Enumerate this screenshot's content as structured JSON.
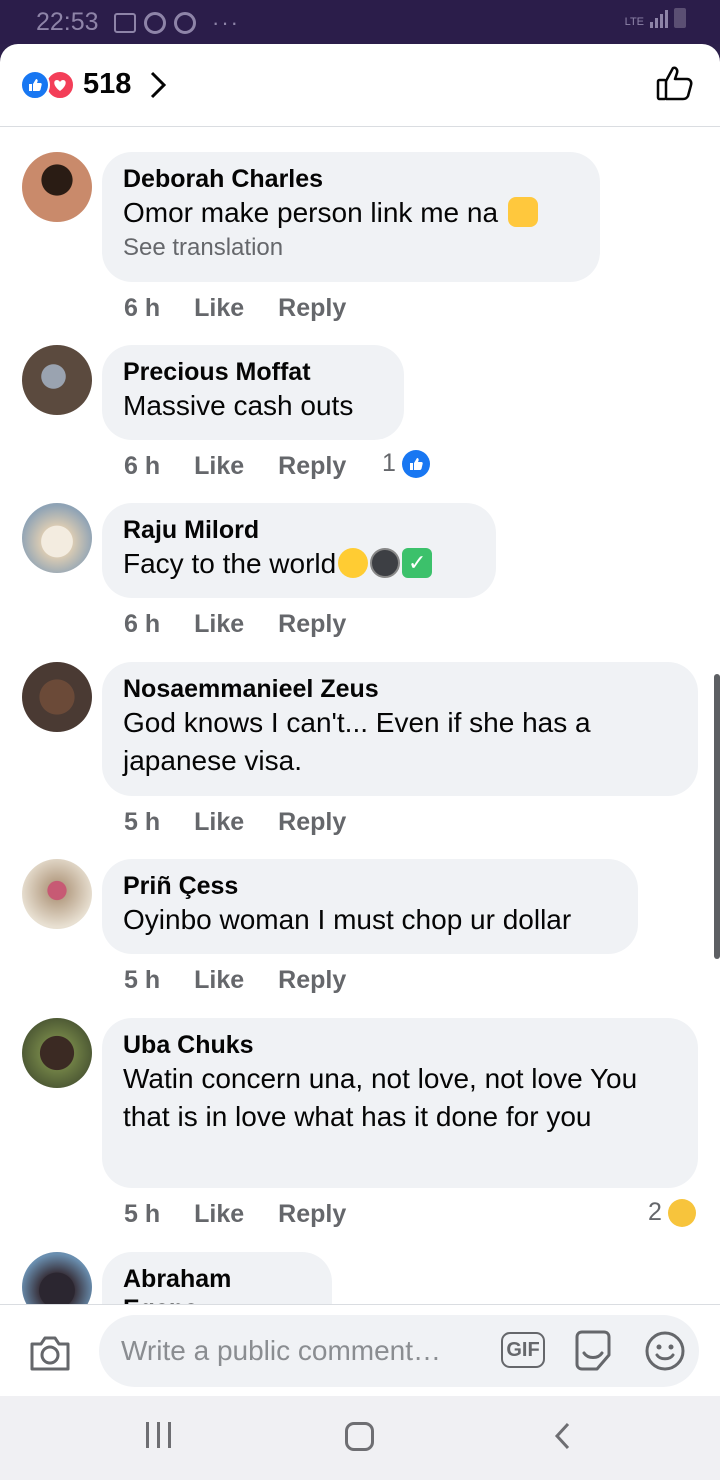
{
  "status_bar": {
    "time": "22:53",
    "network": "LTE"
  },
  "header": {
    "reaction_count": "518"
  },
  "comments": [
    {
      "name": "Deborah Charles",
      "text": "Omor make person link me na",
      "translation": "See translation",
      "time": "6 h",
      "like": "Like",
      "reply": "Reply",
      "reactions": "",
      "avatar_color": "#c98a6b",
      "emoji": "hands"
    },
    {
      "name": "Precious Moffat",
      "text": "Massive cash outs",
      "time": "6 h",
      "like": "Like",
      "reply": "Reply",
      "reactions": "1",
      "avatar_color": "#5b4a3e"
    },
    {
      "name": "Raju Milord",
      "text": "Facy to the world",
      "time": "6 h",
      "like": "Like",
      "reply": "Reply",
      "reactions": "",
      "avatar_color": "#d9cbb4"
    },
    {
      "name": "Nosaemmanieel Zeus",
      "text": "God knows I can't... Even if she has a japanese visa.",
      "time": "5 h",
      "like": "Like",
      "reply": "Reply",
      "reactions": "",
      "avatar_color": "#4a3a33"
    },
    {
      "name": "Priñ Çess",
      "text": "Oyinbo woman I must chop ur dollar",
      "time": "5 h",
      "like": "Like",
      "reply": "Reply",
      "reactions": "",
      "avatar_color": "#b8a289"
    },
    {
      "name": "Uba Chuks",
      "text": "Watin concern una, not love, not love You that is in love what has it done for you",
      "time": "5 h",
      "like": "Like",
      "reply": "Reply",
      "reactions": "2",
      "avatar_color": "#4f5b35"
    },
    {
      "name": "Abraham Egana",
      "avatar_color": "#3a3540"
    }
  ],
  "composer": {
    "placeholder": "Write a public comment…",
    "gif_label": "GIF"
  },
  "colors": {
    "accent": "#1877f2",
    "love": "#f33e58",
    "bubble": "#f0f2f5",
    "muted": "#65676b"
  }
}
